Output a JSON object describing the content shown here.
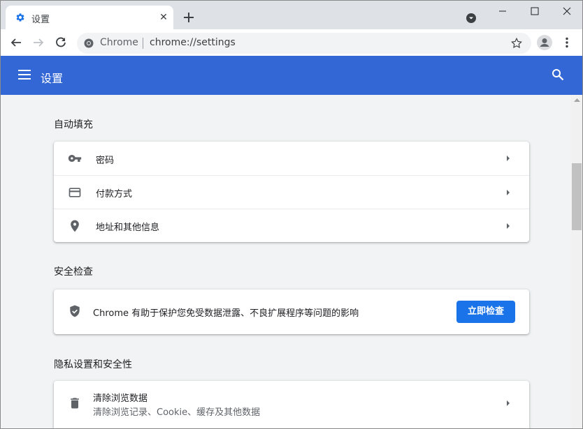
{
  "tab": {
    "title": "设置",
    "close_label": "✕"
  },
  "toolbar": {
    "site_name": "Chrome",
    "url": "chrome://settings"
  },
  "header": {
    "title": "设置"
  },
  "sections": {
    "autofill": {
      "title": "自动填充",
      "items": [
        {
          "label": "密码",
          "icon": "key-icon"
        },
        {
          "label": "付款方式",
          "icon": "credit-card-icon"
        },
        {
          "label": "地址和其他信息",
          "icon": "location-pin-icon"
        }
      ]
    },
    "safety_check": {
      "title": "安全检查",
      "description": "Chrome 有助于保护您免受数据泄露、不良扩展程序等问题的影响",
      "button_label": "立即检查",
      "icon": "shield-icon"
    },
    "privacy": {
      "title": "隐私设置和安全性",
      "items": [
        {
          "label": "清除浏览数据",
          "sublabel": "清除浏览记录、Cookie、缓存及其他数据",
          "icon": "trash-icon"
        }
      ]
    }
  },
  "colors": {
    "accent": "#3367d6",
    "button": "#1a73e8",
    "background": "#f1f3f4"
  }
}
